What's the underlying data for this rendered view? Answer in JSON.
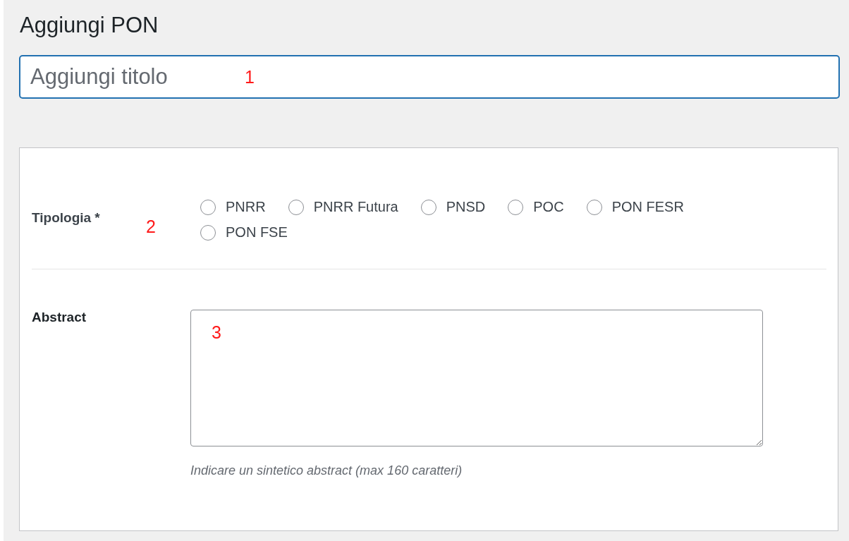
{
  "heading": "Aggiungi PON",
  "title_field": {
    "placeholder": "Aggiungi titolo",
    "marker": "1"
  },
  "fields": [
    {
      "kind": "radio",
      "label": "Tipologia *",
      "marker": "2",
      "options": [
        {
          "label": "PNRR",
          "selected": false
        },
        {
          "label": "PNRR Futura",
          "selected": false
        },
        {
          "label": "PNSD",
          "selected": false
        },
        {
          "label": "POC",
          "selected": false
        },
        {
          "label": "PON FESR",
          "selected": false
        },
        {
          "label": "PON FSE",
          "selected": false
        }
      ]
    },
    {
      "kind": "textarea",
      "label": "Abstract",
      "marker": "3",
      "hint": "Indicare un sintetico abstract (max 160 caratteri)"
    }
  ]
}
